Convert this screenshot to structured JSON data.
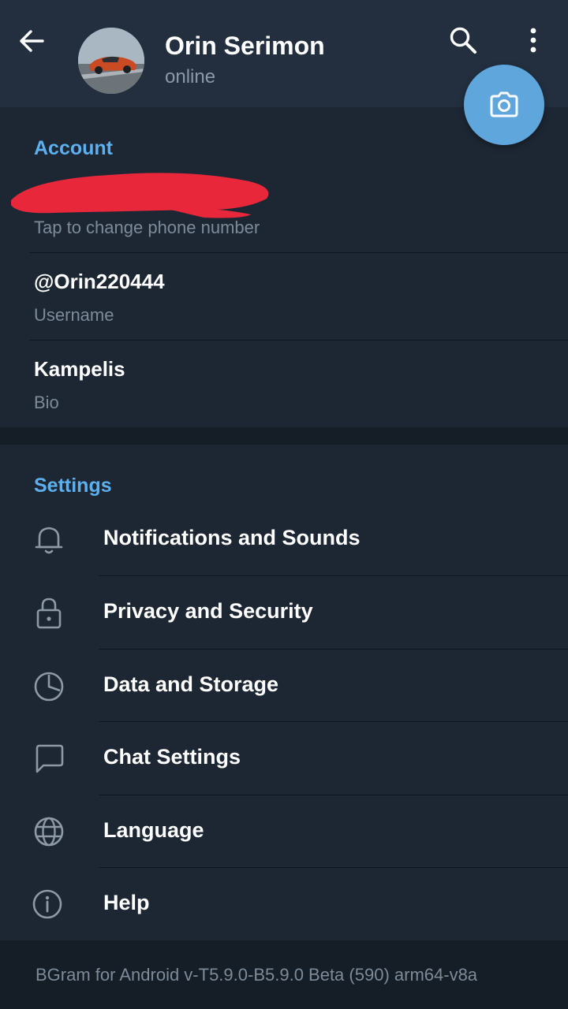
{
  "header": {
    "name": "Orin Serimon",
    "status": "online"
  },
  "account": {
    "title": "Account",
    "phone_hint": "Tap to change phone number",
    "username_value": "@Orin220444",
    "username_label": "Username",
    "bio_value": "Kampelis",
    "bio_label": "Bio"
  },
  "settings": {
    "title": "Settings",
    "items": [
      {
        "label": "Notifications and Sounds",
        "icon": "bell-icon"
      },
      {
        "label": "Privacy and Security",
        "icon": "lock-icon"
      },
      {
        "label": "Data and Storage",
        "icon": "pie-chart-icon"
      },
      {
        "label": "Chat Settings",
        "icon": "chat-bubble-icon"
      },
      {
        "label": "Language",
        "icon": "globe-icon"
      },
      {
        "label": "Help",
        "icon": "info-icon"
      }
    ]
  },
  "footer": {
    "version": "BGram for Android v-T5.9.0-B5.9.0 Beta (590) arm64-v8a"
  },
  "colors": {
    "background": "#1d2733",
    "header": "#232f3e",
    "accent": "#5cb0ef",
    "fab": "#5fa6dc",
    "redaction": "#e8283a"
  }
}
